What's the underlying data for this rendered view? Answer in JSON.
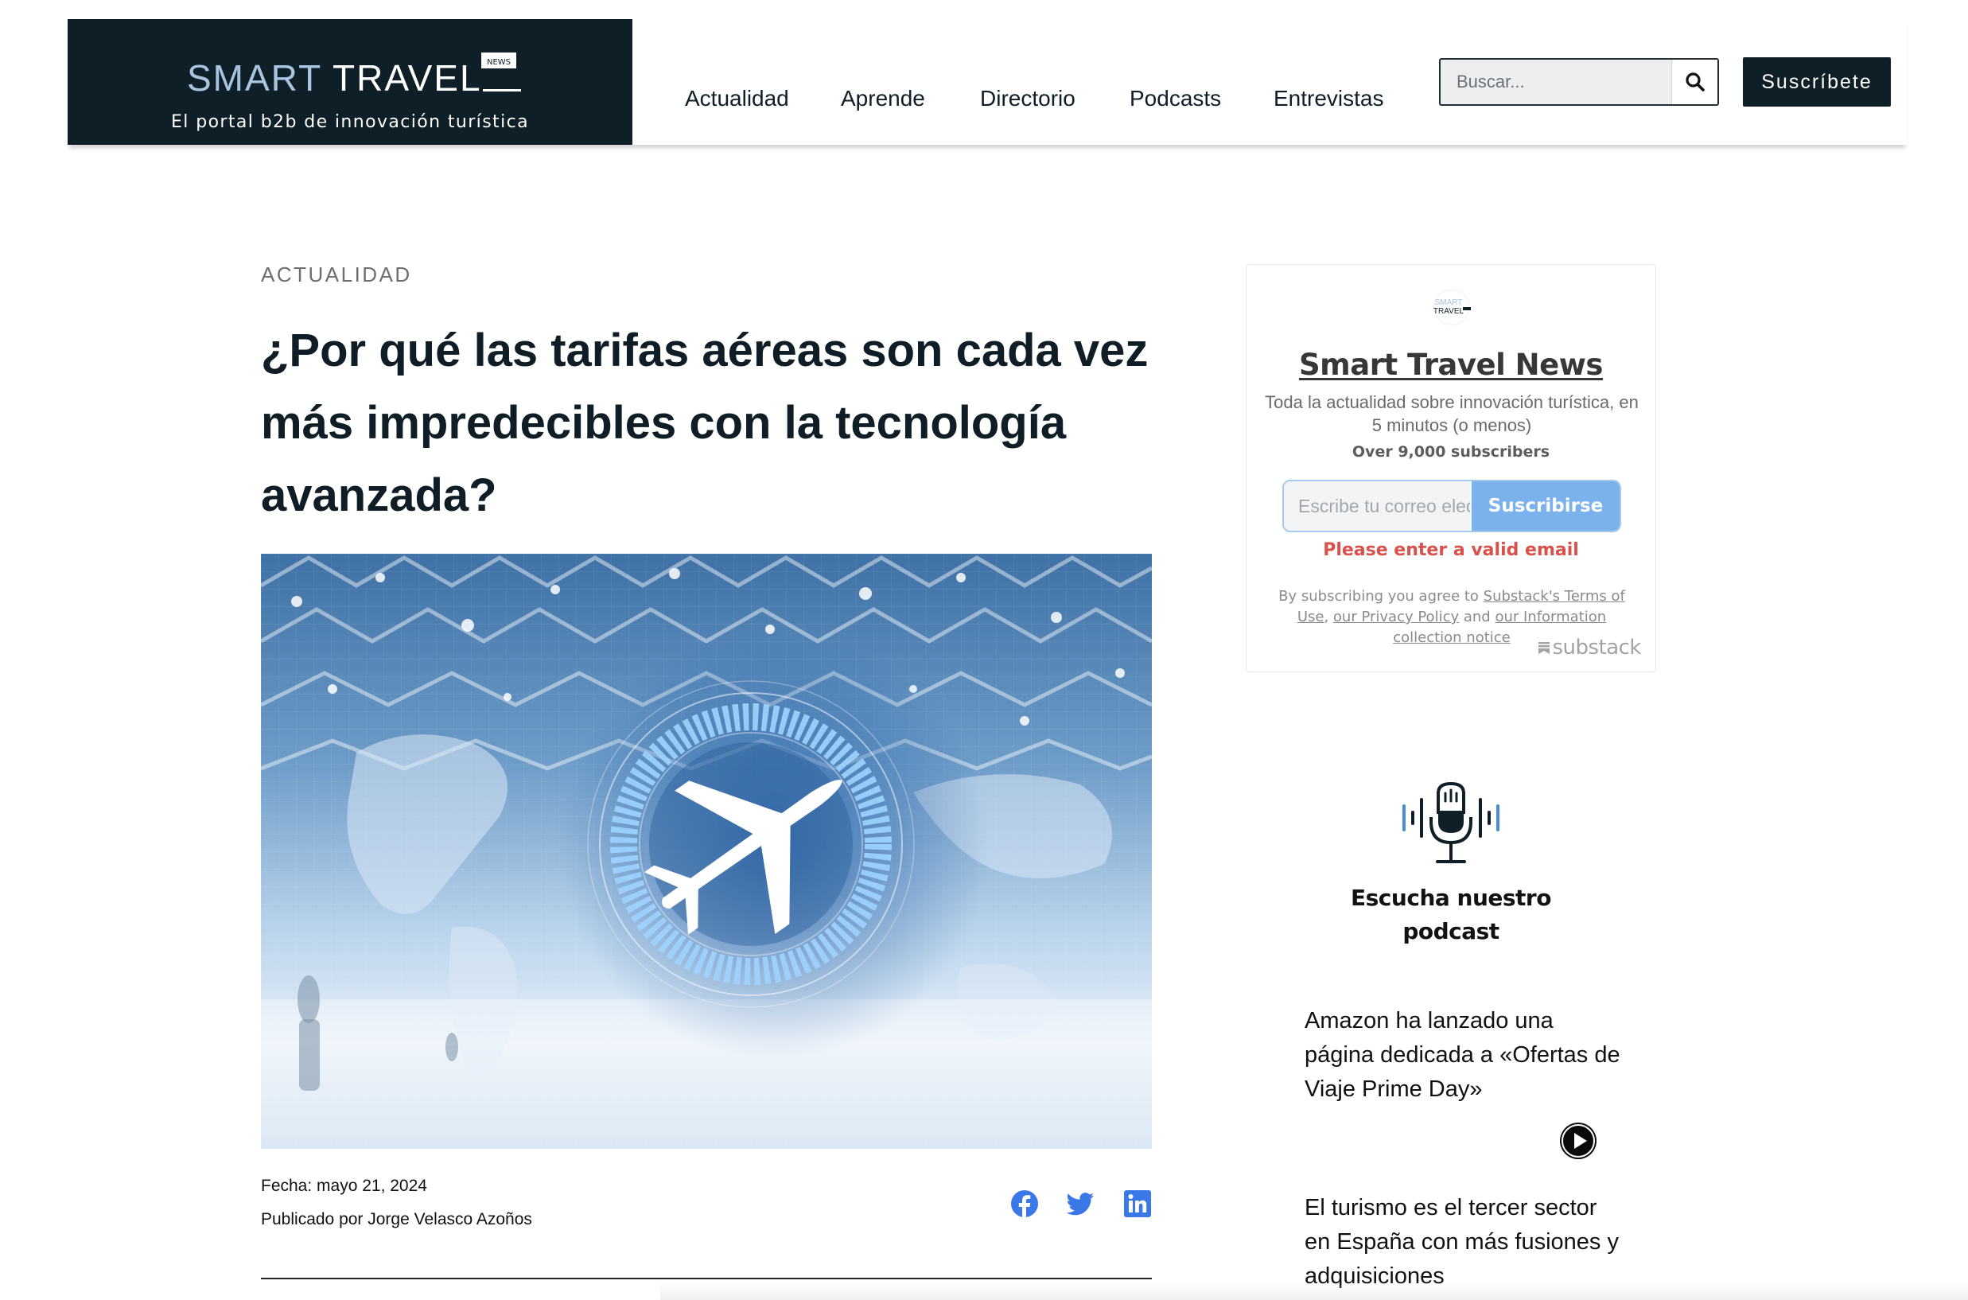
{
  "header": {
    "logo": {
      "brand_left": "SMART",
      "brand_right": "TRAVEL",
      "badge": "NEWS"
    },
    "tagline": "El portal b2b de innovación turística",
    "nav": [
      "Actualidad",
      "Aprende",
      "Directorio",
      "Podcasts",
      "Entrevistas"
    ],
    "search": {
      "placeholder": "Buscar...",
      "icon": "search-icon"
    },
    "subscribe_label": "Suscríbete"
  },
  "article": {
    "category": "ACTUALIDAD",
    "title": "¿Por qué las tarifas aéreas son cada vez más impredecibles con la tecnología avanzada?",
    "date": "Fecha: mayo 21, 2024",
    "author": "Publicado por Jorge Velasco Azoños",
    "share": [
      "facebook-icon",
      "twitter-icon",
      "linkedin-icon"
    ]
  },
  "newsletter": {
    "logo": {
      "line1": "SMART",
      "line2": "TRAVEL"
    },
    "title": "Smart Travel News",
    "description": "Toda la actualidad sobre innovación turística, en 5 minutos (o menos)",
    "subscribers": "Over 9,000 subscribers",
    "email_placeholder": "Escribe tu correo electrónico",
    "button_label": "Suscribirse",
    "error": "Please enter a valid email",
    "legal": {
      "prefix": "By subscribing you agree to ",
      "terms": "Substack's Terms of Use",
      "sep1": ", ",
      "privacy": "our Privacy Policy",
      "sep2": " and ",
      "notice": "our Information collection notice"
    },
    "badge": "substack"
  },
  "podcast": {
    "title": "Escucha nuestro podcast",
    "episodes": [
      "Amazon ha lanzado una página dedicada a «Ofertas de Viaje Prime Day»",
      "El turismo es el tercer sector en España con más fusiones y adquisiciones"
    ]
  },
  "colors": {
    "navy": "#0f1f28",
    "share_blue": "#3b78e7",
    "substack_button": "#7bb1ec",
    "error": "#d9514c"
  }
}
